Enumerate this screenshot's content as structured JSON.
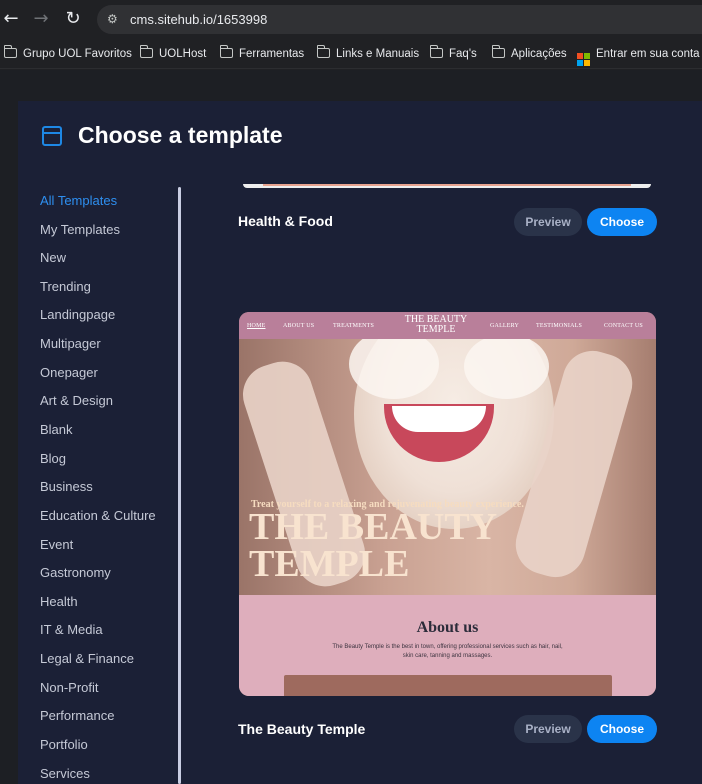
{
  "browser": {
    "url": "cms.sitehub.io/1653998",
    "bookmarks": [
      {
        "label": "Grupo UOL Favoritos",
        "icon": "bookmarks-folder-icon"
      },
      {
        "label": "UOLHost",
        "icon": "folder-icon"
      },
      {
        "label": "Ferramentas",
        "icon": "folder-icon"
      },
      {
        "label": "Links e Manuais",
        "icon": "folder-icon"
      },
      {
        "label": "Faq's",
        "icon": "folder-icon"
      },
      {
        "label": "Aplicações",
        "icon": "folder-icon"
      },
      {
        "label": "Entrar em sua conta",
        "icon": "microsoft-icon"
      }
    ]
  },
  "modal": {
    "title": "Choose a template",
    "icon": "browser-window-icon"
  },
  "sidebar": {
    "active_index": 0,
    "items": [
      "All Templates",
      "My Templates",
      "New",
      "Trending",
      "Landingpage",
      "Multipager",
      "Onepager",
      "Art & Design",
      "Blank",
      "Blog",
      "Business",
      "Education & Culture",
      "Event",
      "Gastronomy",
      "Health",
      "IT & Media",
      "Legal & Finance",
      "Non-Profit",
      "Performance",
      "Portfolio",
      "Services"
    ]
  },
  "templates": [
    {
      "name": "Health & Food",
      "preview_label": "Preview",
      "choose_label": "Choose"
    },
    {
      "name": "The Beauty Temple",
      "preview_label": "Preview",
      "choose_label": "Choose"
    }
  ],
  "thumbnail": {
    "nav": [
      "HOME",
      "ABOUT US",
      "TREATMENTS",
      "GALLERY",
      "TESTIMONIALS",
      "CONTACT US"
    ],
    "logo": "THE BEAUTY TEMPLE",
    "tagline": "Treat yourself to a relaxing and rejuvenating beauty experience.",
    "hero_title": "THE BEAUTY TEMPLE",
    "about_heading": "About us",
    "about_text": "The Beauty Temple is the best in town, offering professional services such as hair, nail, skin care, tanning and massages."
  },
  "colors": {
    "accent": "#0d84f2",
    "active_category": "#2e8ff0",
    "modal_bg": "#1b2036"
  }
}
